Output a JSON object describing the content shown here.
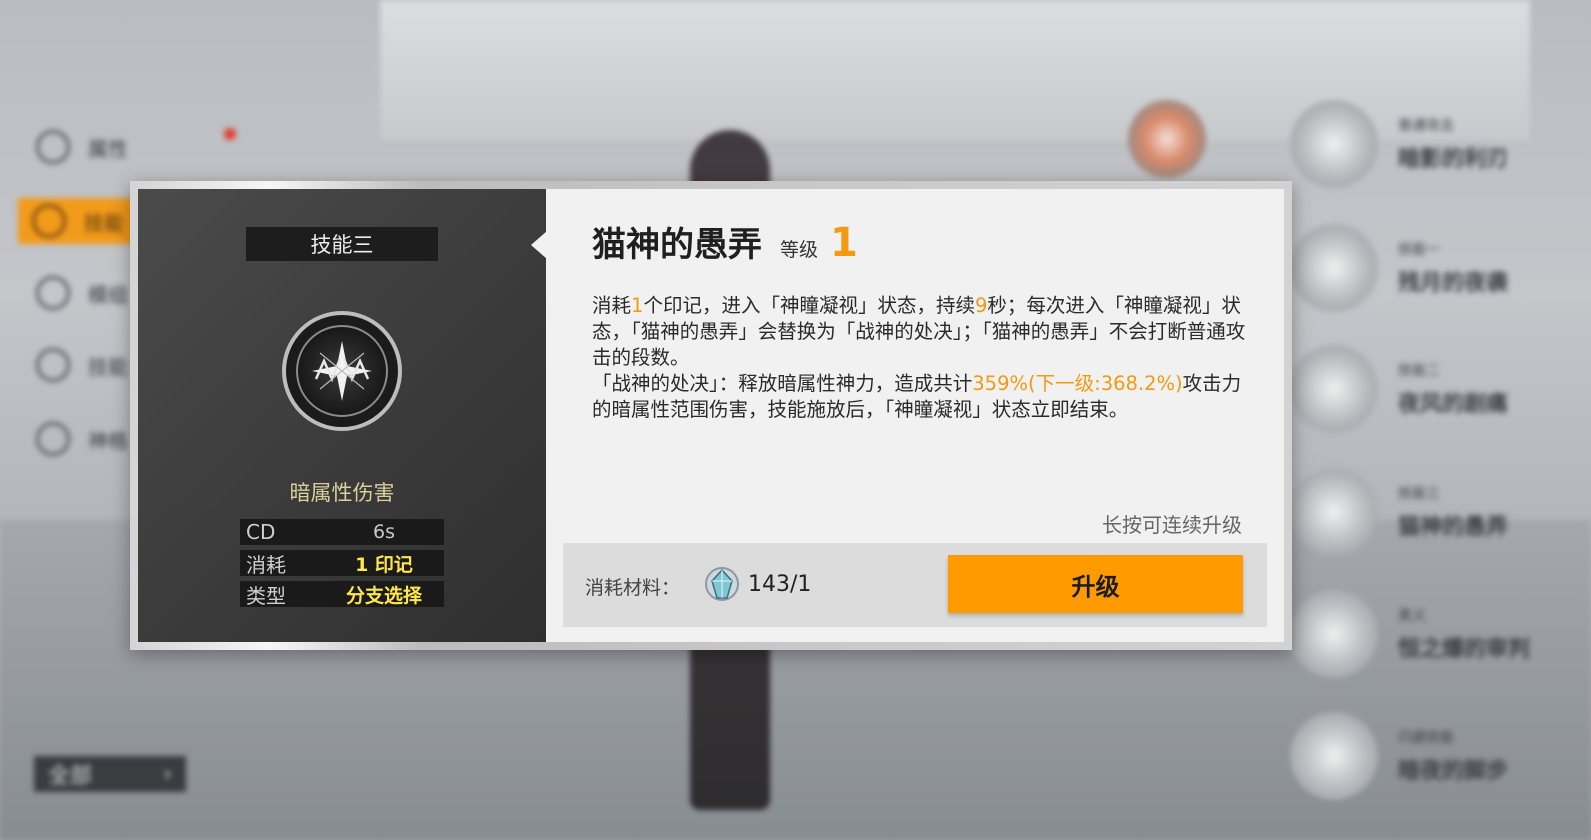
{
  "background": {
    "sidebar_items": [
      {
        "label": "属性",
        "icon": "target-icon"
      },
      {
        "label": "技能",
        "icon": "gear-icon"
      },
      {
        "label": "模组",
        "icon": "module-icon"
      },
      {
        "label": "技能",
        "icon": "triangle-icon"
      },
      {
        "label": "神格",
        "icon": "crest-icon"
      }
    ],
    "filter_button": {
      "label": "全部",
      "arrow": "›"
    },
    "right_skills": [
      {
        "small": "普通攻击",
        "big": "暗影的利刃"
      },
      {
        "small": "技能一",
        "big": "残月的夜袭"
      },
      {
        "small": "技能二",
        "big": "夜风的剧痛"
      },
      {
        "small": "技能三",
        "big": "猫神的愚弄"
      },
      {
        "small": "奥义",
        "big": "恒之爆的审判"
      },
      {
        "small": "闪避技能",
        "big": "暗夜的脚步"
      }
    ]
  },
  "skill": {
    "slot_label": "技能三",
    "emblem_icon": "dark-star-emblem-icon",
    "damage_type": "暗属性伤害",
    "stats": [
      {
        "key": "CD",
        "value": "6s"
      },
      {
        "key": "消耗",
        "value": "1 印记"
      },
      {
        "key": "类型",
        "value": "分支选择"
      }
    ],
    "name": "猫神的愚弄",
    "level_label": "等级",
    "level_value": "1",
    "description": {
      "p1_a": "消耗",
      "p1_n1": "1",
      "p1_b": "个印记，进入「神瞳凝视」状态，持续",
      "p1_n2": "9",
      "p1_c": "秒；每次进入「神瞳凝视」状态，「猫神的愚弄」会替换为「战神的处决」；「猫神的愚弄」不会打断普通攻击的段数。",
      "p2_a": "「战神的处决」：释放暗属性神力，造成共计",
      "p2_hl": "359%(下一级:368.2%)",
      "p2_b": "攻击力的暗属性范围伤害，技能施放后，「神瞳凝视」状态立即结束。"
    },
    "hold_hint": "长按可连续升级",
    "cost_label": "消耗材料：",
    "material_icon": "crystal-material-icon",
    "material_count": "143/1",
    "upgrade_label": "升级"
  },
  "colors": {
    "accent": "#ff9a00",
    "highlight": "#f39a12",
    "stat_highlight": "#ffe74a"
  }
}
